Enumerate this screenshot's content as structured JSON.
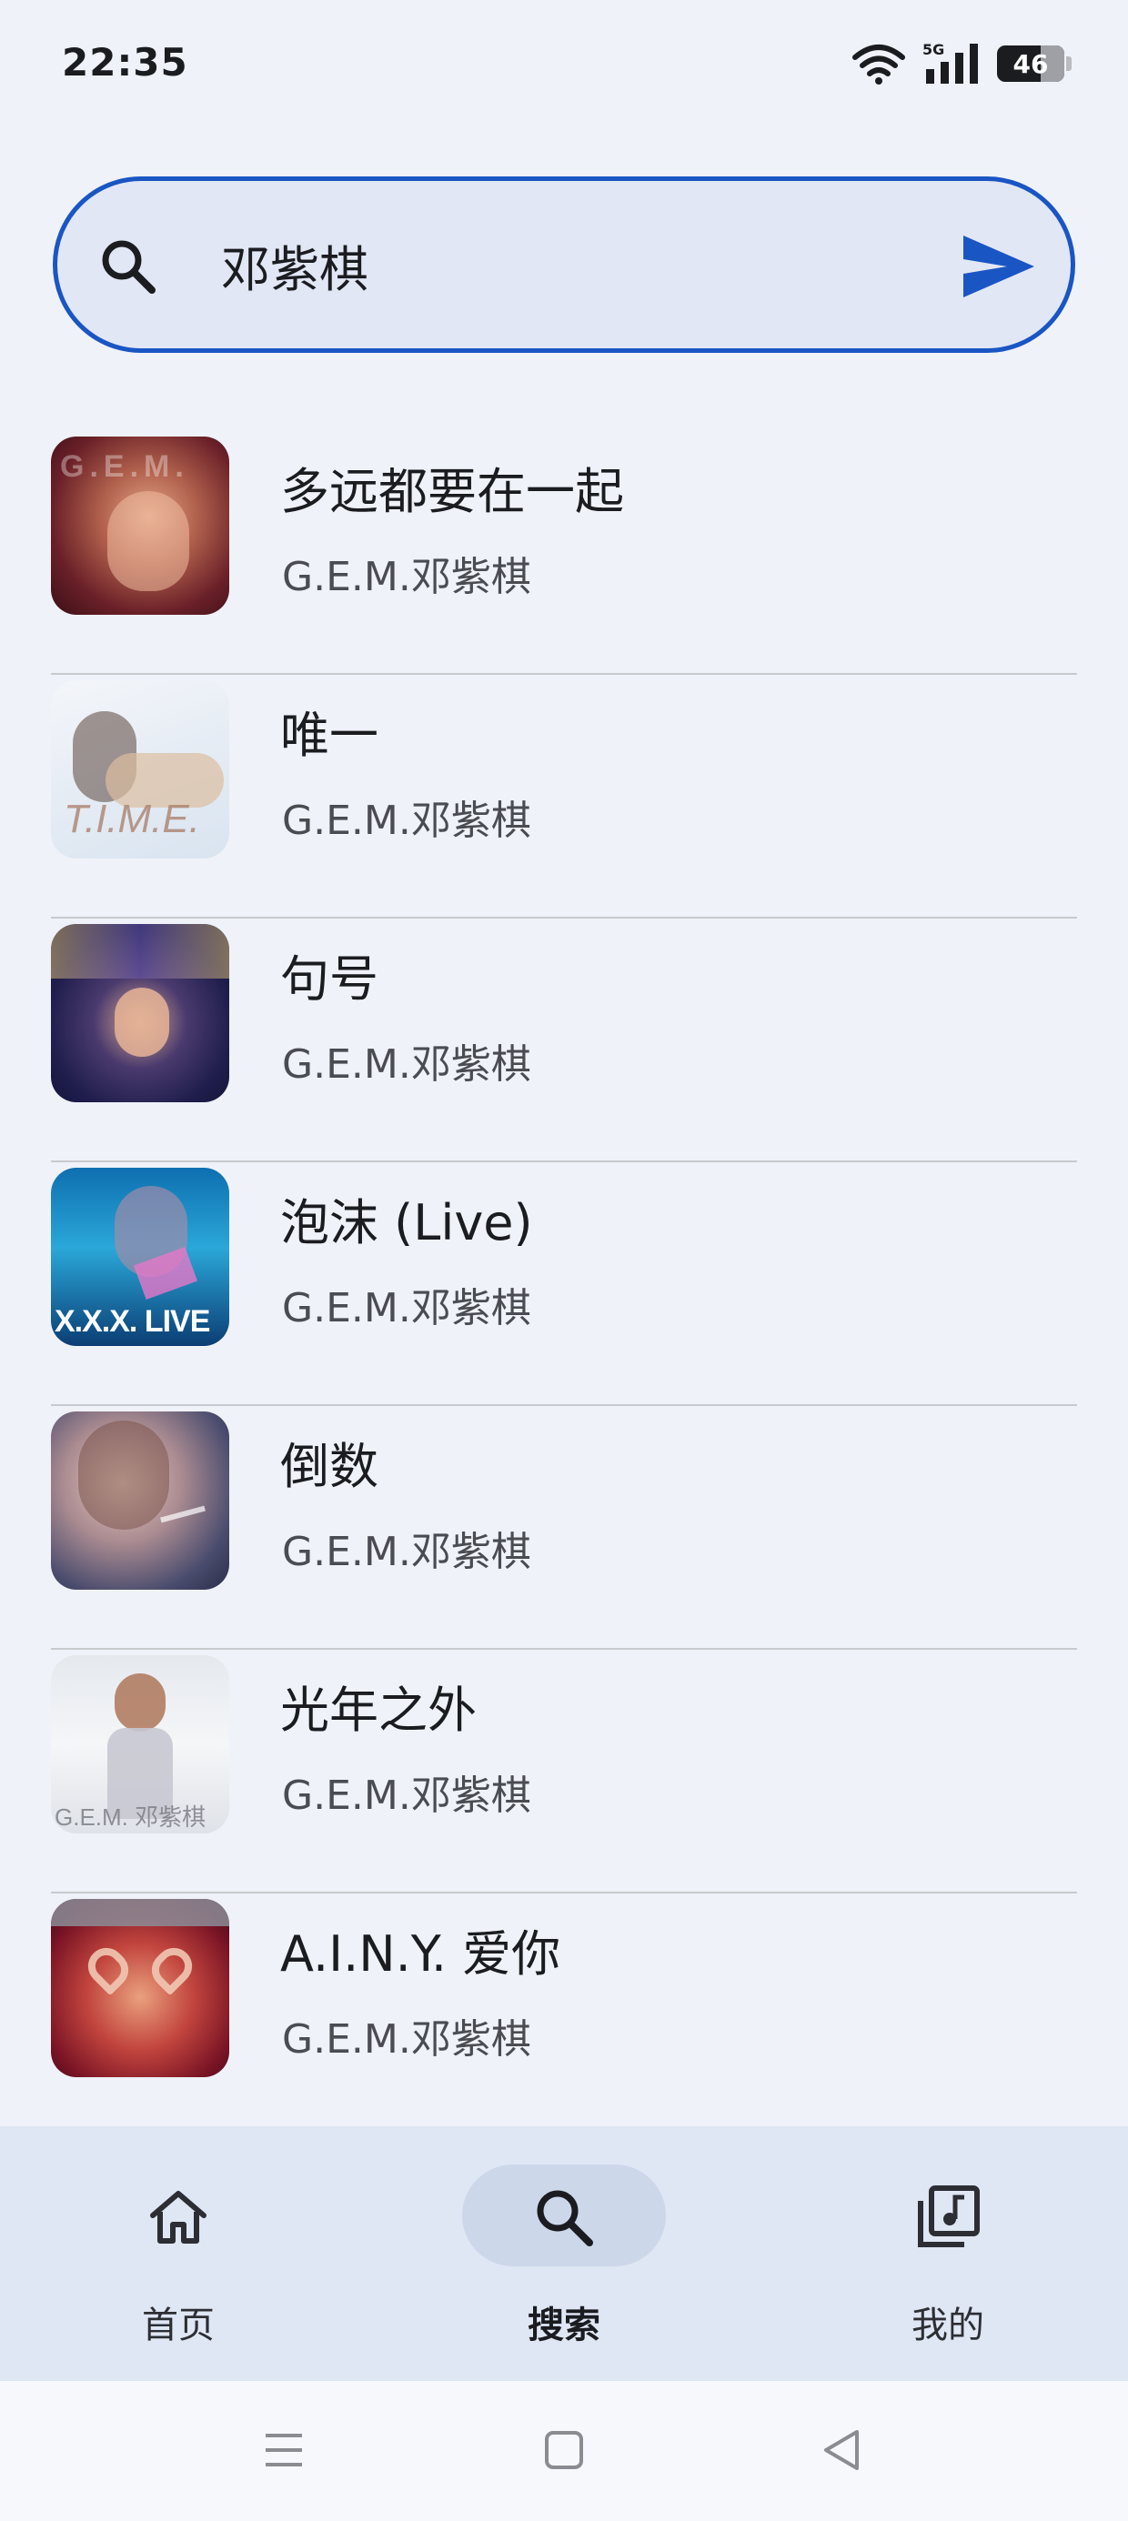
{
  "status_bar": {
    "time": "22:35",
    "network": "5G",
    "battery": "46"
  },
  "search": {
    "query": "邓紫棋"
  },
  "results": [
    {
      "title": "多远都要在一起",
      "artist": "G.E.M.邓紫棋",
      "cover_text": "G.E.M."
    },
    {
      "title": "唯一",
      "artist": "G.E.M.邓紫棋",
      "cover_text": "T.I.M.E."
    },
    {
      "title": "句号",
      "artist": "G.E.M.邓紫棋",
      "cover_text": ""
    },
    {
      "title": "泡沫 (Live)",
      "artist": "G.E.M.邓紫棋",
      "cover_text": "X.X.X. LIVE"
    },
    {
      "title": "倒数",
      "artist": "G.E.M.邓紫棋",
      "cover_text": ""
    },
    {
      "title": "光年之外",
      "artist": "G.E.M.邓紫棋",
      "cover_text": "G.E.M. 邓紫棋"
    },
    {
      "title": "A.I.N.Y. 爱你",
      "artist": "G.E.M.邓紫棋",
      "cover_text": ""
    }
  ],
  "bottom_nav": {
    "items": [
      {
        "label": "首页",
        "icon": "home-icon",
        "active": false
      },
      {
        "label": "搜索",
        "icon": "search-icon",
        "active": true
      },
      {
        "label": "我的",
        "icon": "library-music-icon",
        "active": false
      }
    ]
  },
  "colors": {
    "accent": "#1a55c4",
    "background": "#eff2f8",
    "nav_background": "#dfe6f4"
  }
}
